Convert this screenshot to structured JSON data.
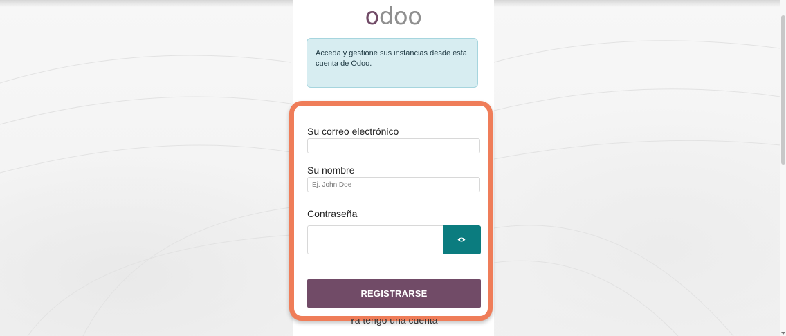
{
  "brand": {
    "logo_text": "odoo"
  },
  "info": {
    "message": "Acceda y gestione sus instancias desde esta cuenta de Odoo."
  },
  "form": {
    "email_label": "Su correo electrónico",
    "email_value": "",
    "name_label": "Su nombre",
    "name_placeholder": "Ej. John Doe",
    "password_label": "Contraseña",
    "password_value": "",
    "show_password_icon": "eye-icon",
    "submit_label": "REGISTRARSE"
  },
  "footer": {
    "login_link": "Ya tengo una cuenta"
  },
  "colors": {
    "brand": "#714b67",
    "accent": "#0b7c7f",
    "highlight": "#ef7d59",
    "info_bg": "#d7edf1"
  }
}
